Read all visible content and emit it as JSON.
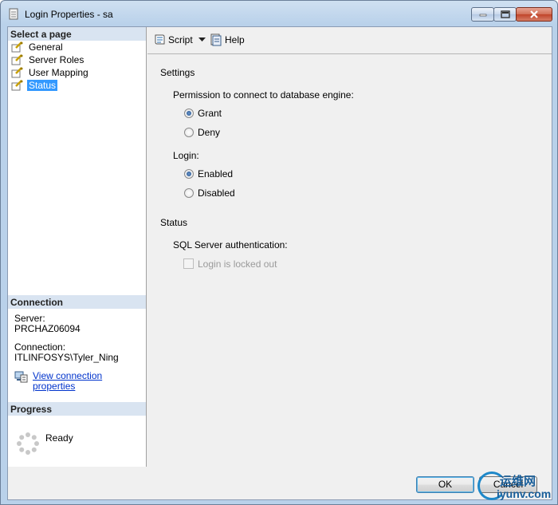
{
  "window": {
    "title": "Login Properties - sa"
  },
  "left": {
    "select_header": "Select a page",
    "pages": [
      {
        "label": "General",
        "icon": "page-settings-icon",
        "selected": false
      },
      {
        "label": "Server Roles",
        "icon": "page-settings-icon",
        "selected": false
      },
      {
        "label": "User Mapping",
        "icon": "page-settings-icon",
        "selected": false
      },
      {
        "label": "Status",
        "icon": "page-settings-icon",
        "selected": true
      }
    ],
    "connection": {
      "header": "Connection",
      "server_label": "Server:",
      "server_value": "PRCHAZ06094",
      "connection_label": "Connection:",
      "connection_value": "ITLINFOSYS\\Tyler_Ning",
      "view_link": "View connection properties"
    },
    "progress": {
      "header": "Progress",
      "status": "Ready"
    }
  },
  "toolbar": {
    "script_label": "Script",
    "help_label": "Help"
  },
  "content": {
    "settings_label": "Settings",
    "permission_label": "Permission to connect to database engine:",
    "permission_options": [
      {
        "label": "Grant",
        "checked": true
      },
      {
        "label": "Deny",
        "checked": false
      }
    ],
    "login_label": "Login:",
    "login_options": [
      {
        "label": "Enabled",
        "checked": true
      },
      {
        "label": "Disabled",
        "checked": false
      }
    ],
    "status_label": "Status",
    "sql_auth_label": "SQL Server authentication:",
    "locked_out_label": "Login is locked out"
  },
  "footer": {
    "ok_label": "OK",
    "cancel_label": "Cancel"
  },
  "watermark": {
    "cn": "运维网",
    "en": "iyunv.com"
  },
  "colors": {
    "selection": "#3399ff",
    "pane_header": "#d9e4f1",
    "link": "#0033cc"
  }
}
